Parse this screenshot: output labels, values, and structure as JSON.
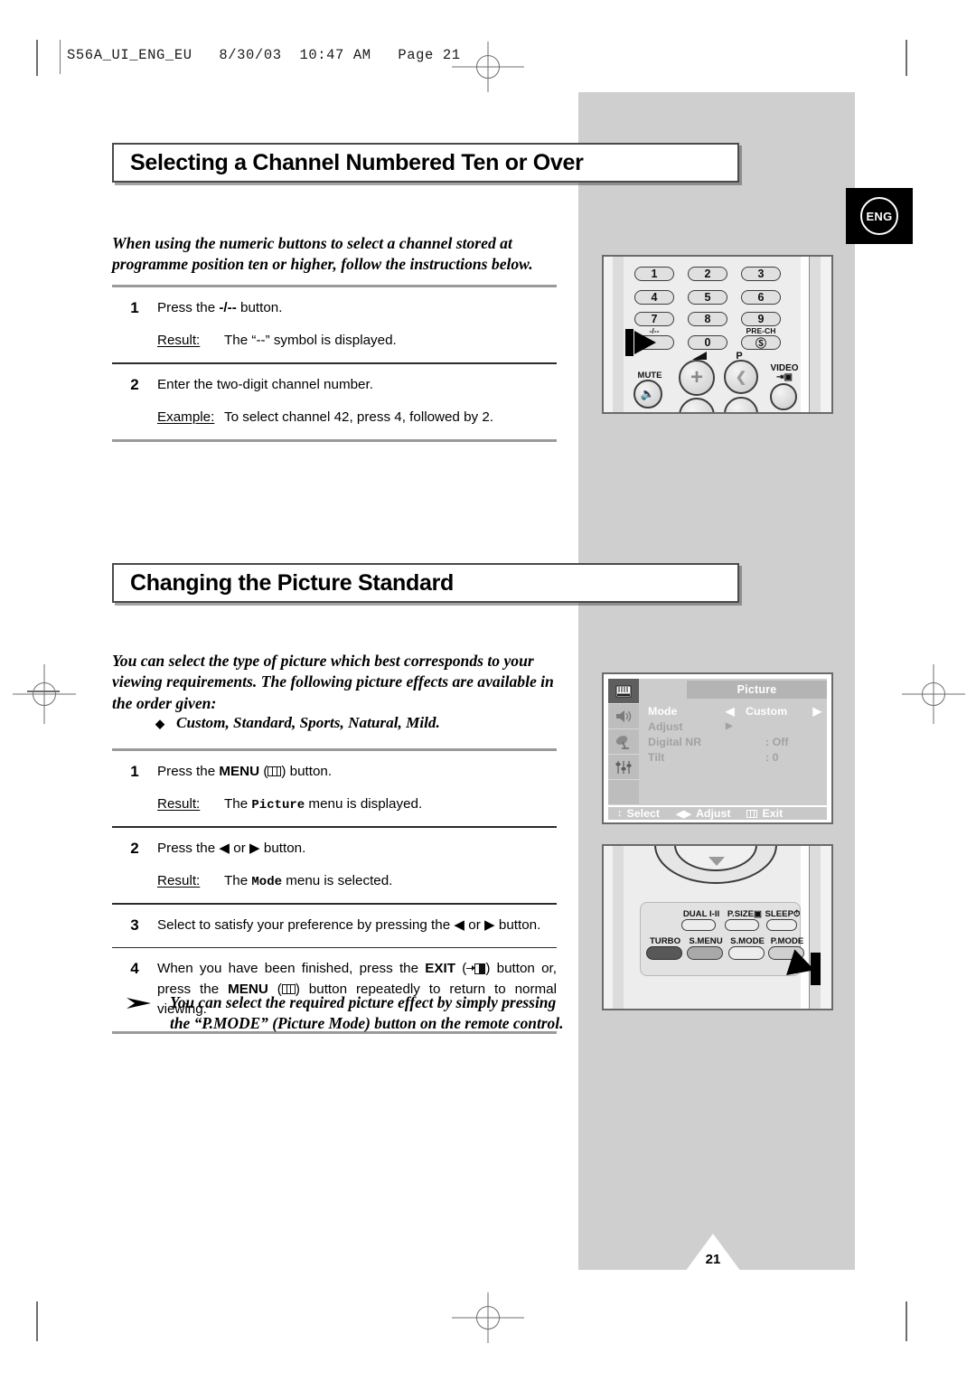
{
  "header": {
    "slug": "S56A_UI_ENG_EU   8/30/03  10:47 AM   Page 21"
  },
  "language_badge": {
    "label": "ENG"
  },
  "page_number": "21",
  "sections": [
    {
      "title": "Selecting a Channel Numbered Ten or Over",
      "intro": "When using the numeric buttons to select a channel stored at programme position ten or higher, follow the instructions below.",
      "steps": [
        {
          "number": "1",
          "text_before": "Press the ",
          "text_bold": "-/--",
          "text_after": " button.",
          "sub_label": "Result:",
          "sub_text": "The “--” symbol is displayed."
        },
        {
          "number": "2",
          "text_before": "Enter the two-digit channel number.",
          "text_bold": "",
          "text_after": "",
          "sub_label": "Example:",
          "sub_text": "To select channel 42, press 4, followed by 2."
        }
      ]
    },
    {
      "title": "Changing the Picture Standard",
      "intro": "You can select the type of picture which best corresponds to your viewing requirements. The following picture effects are available in the order given:",
      "bullet": "Custom, Standard, Sports, Natural, Mild.",
      "steps": [
        {
          "number": "1",
          "text_before": "Press the ",
          "text_bold": "MENU",
          "icon": "menu-icon",
          "text_after": " button.",
          "sub_label": "Result:",
          "sub_text_before": "The ",
          "sub_term": "Picture",
          "sub_text_after": " menu is displayed."
        },
        {
          "number": "2",
          "text_before": "Press the ◀ or ▶ button.",
          "sub_label": "Result:",
          "sub_text_before": "The ",
          "sub_term": "Mode",
          "sub_text_after": " menu is selected."
        },
        {
          "number": "3",
          "text_before": "Select to satisfy your preference by pressing the ◀ or ▶ button."
        },
        {
          "number": "4",
          "part1": "When you have been finished, press the ",
          "bold1": "EXIT",
          "icon1": "exit-icon",
          "part2": " button or, press the ",
          "bold2": "MENU",
          "icon2": "menu-icon",
          "part3": " button repeatedly to return to normal viewing."
        }
      ],
      "note": "You can select the required picture effect by simply pressing the “P.MODE” (Picture Mode) button on the remote control."
    }
  ],
  "figures": {
    "remote_top": {
      "name": "remote-numeric-keypad",
      "keys": [
        "1",
        "2",
        "3",
        "4",
        "5",
        "6",
        "7",
        "8",
        "9",
        "0"
      ],
      "minus_key_label": "-/--",
      "pre_ch_label": "PRE-CH",
      "pre_ch_glyph": "Ⓢ",
      "mute_label": "MUTE",
      "volume_plus": "+",
      "programme_label": "P",
      "video_label": "VIDEO"
    },
    "osd": {
      "name": "picture-menu-osd",
      "header": "Picture",
      "rows": [
        {
          "label": "Mode",
          "value": "Custom",
          "state": "active",
          "arrows": true
        },
        {
          "label": "Adjust",
          "value": "▶",
          "state": "dim",
          "arrows": false
        },
        {
          "label": "Digital NR",
          "value": ": Off",
          "state": "dim",
          "arrows": false
        },
        {
          "label": "Tilt",
          "value": ": 0",
          "state": "dim",
          "arrows": false
        }
      ],
      "footer": [
        {
          "glyph": "↕",
          "label": "Select"
        },
        {
          "glyph": "◀▶",
          "label": "Adjust"
        },
        {
          "glyph": "menu-icon",
          "label": "Exit"
        }
      ],
      "rail_icons": [
        "picture-icon",
        "sound-icon",
        "channel-icon",
        "setup-icon",
        "blank-icon"
      ]
    },
    "remote_bottom": {
      "name": "remote-function-keys",
      "row1": [
        "DUAL I-II",
        "P.SIZE",
        "SLEEP"
      ],
      "row2": [
        "TURBO",
        "S.MENU",
        "S.MODE",
        "P.MODE"
      ],
      "highlighted_key": "P.MODE"
    }
  }
}
